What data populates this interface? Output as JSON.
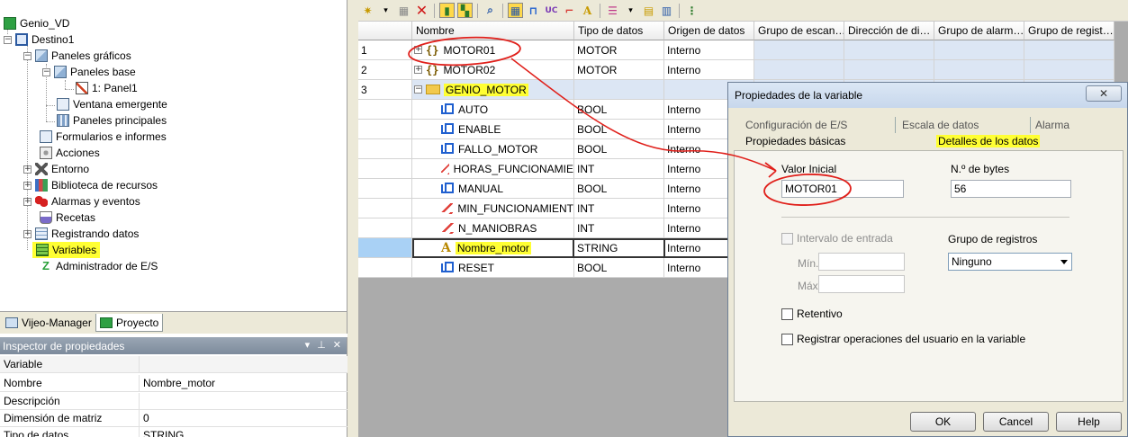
{
  "tree": {
    "root": "Genio_VD",
    "items": [
      {
        "label": "Destino1",
        "icon": "target-window-icon"
      },
      {
        "label": "Paneles gráficos",
        "icon": "panels-icon"
      },
      {
        "label": "Paneles base",
        "icon": "panels-icon"
      },
      {
        "label": "1: Panel1",
        "icon": "panel-icon"
      },
      {
        "label": "Ventana emergente",
        "icon": "popup-window-icon"
      },
      {
        "label": "Paneles principales",
        "icon": "master-panels-icon"
      },
      {
        "label": "Formularios e informes",
        "icon": "forms-icon"
      },
      {
        "label": "Acciones",
        "icon": "actions-icon"
      },
      {
        "label": "Entorno",
        "icon": "environment-icon"
      },
      {
        "label": "Biblioteca de recursos",
        "icon": "library-icon"
      },
      {
        "label": "Alarmas y eventos",
        "icon": "alarms-icon"
      },
      {
        "label": "Recetas",
        "icon": "recipes-icon"
      },
      {
        "label": "Registrando datos",
        "icon": "logging-icon"
      },
      {
        "label": "Variables",
        "icon": "variables-icon"
      },
      {
        "label": "Administrador de E/S",
        "icon": "io-manager-icon"
      }
    ]
  },
  "bottom_tabs": [
    "Vijeo-Manager",
    "Proyecto"
  ],
  "inspector": {
    "title": "Inspector de propiedades",
    "group": "Variable",
    "rows": [
      {
        "key": "Nombre",
        "value": "Nombre_motor"
      },
      {
        "key": "Descripción",
        "value": ""
      },
      {
        "key": "Dimensión de matriz",
        "value": "0"
      },
      {
        "key": "Tipo de datos",
        "value": "STRING"
      }
    ]
  },
  "grid": {
    "columns": [
      "Nombre",
      "Tipo de datos",
      "Origen de datos",
      "Grupo de escan…",
      "Dirección de di…",
      "Grupo de alarm…",
      "Grupo de regist…"
    ],
    "rows": [
      {
        "num": "1",
        "name": "MOTOR01",
        "type": "MOTOR",
        "origin": "Interno",
        "icon": "struct",
        "indent": 0,
        "expander": "+"
      },
      {
        "num": "2",
        "name": "MOTOR02",
        "type": "MOTOR",
        "origin": "Interno",
        "icon": "struct",
        "indent": 0,
        "expander": "+"
      },
      {
        "num": "3",
        "name": "GENIO_MOTOR",
        "type": "",
        "origin": "",
        "icon": "folder",
        "indent": 0,
        "expander": "−"
      },
      {
        "num": "",
        "name": "AUTO",
        "type": "BOOL",
        "origin": "Interno",
        "icon": "bool",
        "indent": 1
      },
      {
        "num": "",
        "name": "ENABLE",
        "type": "BOOL",
        "origin": "Interno",
        "icon": "bool",
        "indent": 1
      },
      {
        "num": "",
        "name": "FALLO_MOTOR",
        "type": "BOOL",
        "origin": "Interno",
        "icon": "bool",
        "indent": 1
      },
      {
        "num": "",
        "name": "HORAS_FUNCIONAMIE",
        "type": "INT",
        "origin": "Interno",
        "icon": "int",
        "indent": 1
      },
      {
        "num": "",
        "name": "MANUAL",
        "type": "BOOL",
        "origin": "Interno",
        "icon": "bool",
        "indent": 1
      },
      {
        "num": "",
        "name": "MIN_FUNCIONAMIENT",
        "type": "INT",
        "origin": "Interno",
        "icon": "int",
        "indent": 1
      },
      {
        "num": "",
        "name": "N_MANIOBRAS",
        "type": "INT",
        "origin": "Interno",
        "icon": "int",
        "indent": 1
      },
      {
        "num": "",
        "name": "Nombre_motor",
        "type": "STRING",
        "origin": "Interno",
        "icon": "string",
        "indent": 1
      },
      {
        "num": "",
        "name": "RESET",
        "type": "BOOL",
        "origin": "Interno",
        "icon": "bool",
        "indent": 1
      }
    ]
  },
  "dialog": {
    "title": "Propiedades de la variable",
    "close": "✕",
    "tabs_back": [
      "Configuración de E/S",
      "Escala de datos",
      "Alarma"
    ],
    "tabs_front": [
      "Propiedades básicas",
      "Detalles de los datos"
    ],
    "valor_inicial_label": "Valor Inicial",
    "valor_inicial": "MOTOR01",
    "num_bytes_label": "N.º de bytes",
    "num_bytes": "56",
    "intervalo_label": "Intervalo de entrada",
    "min_label": "Mín.",
    "max_label": "Máx.",
    "grupo_registros_label": "Grupo de registros",
    "grupo_registros": "Ninguno",
    "retentivo_label": "Retentivo",
    "registrar_label": "Registrar operaciones del usuario en la variable",
    "ok": "OK",
    "cancel": "Cancel",
    "help": "Help"
  },
  "colors": {
    "highlight_yellow": "#ffff33",
    "annotation_red": "#e0201b",
    "selection_blue": "#a9d1f5"
  }
}
